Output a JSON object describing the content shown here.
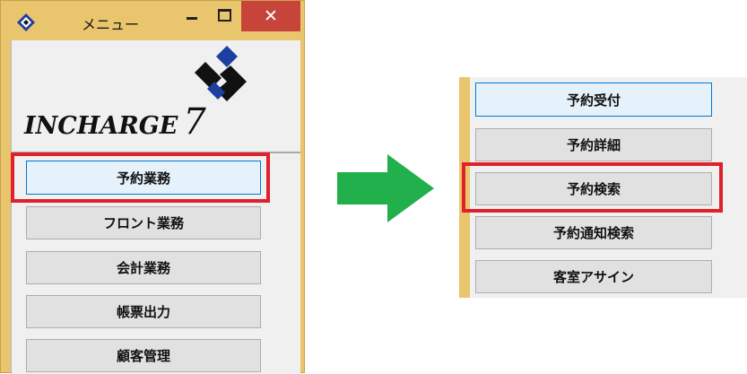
{
  "window": {
    "title": "メニュー",
    "close_symbol": "✕",
    "logo_brand": "INCHARGE",
    "logo_version": "7"
  },
  "menu_buttons": [
    {
      "label": "予約業務"
    },
    {
      "label": "フロント業務"
    },
    {
      "label": "会計業務"
    },
    {
      "label": "帳票出力"
    },
    {
      "label": "顧客管理"
    }
  ],
  "submenu_buttons": [
    {
      "label": "予約受付"
    },
    {
      "label": "予約詳細"
    },
    {
      "label": "予約検索"
    },
    {
      "label": "予約通知検索"
    },
    {
      "label": "客室アサイン"
    }
  ],
  "colors": {
    "window_frame": "#e9c56d",
    "highlight": "#e0202a",
    "arrow": "#21b04b",
    "logo_blue": "#1f3fa0",
    "close_button": "#c7443b"
  },
  "icons": {
    "app": "incharge-logo-icon",
    "arrow": "arrow-right-icon"
  }
}
